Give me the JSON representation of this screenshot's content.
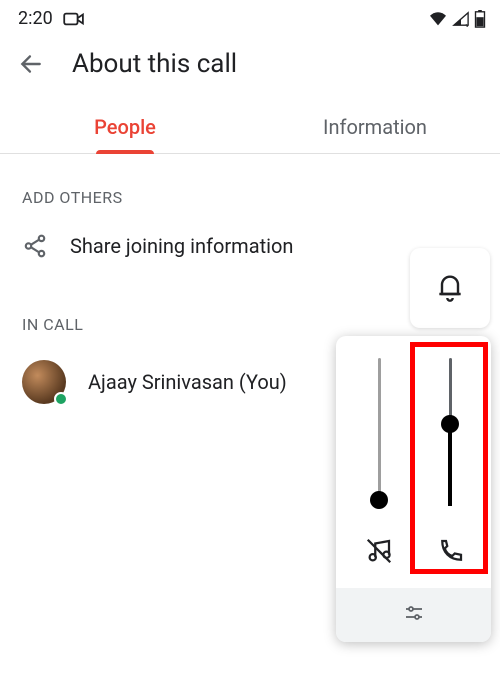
{
  "status": {
    "time": "2:20"
  },
  "header": {
    "title": "About this call"
  },
  "tabs": {
    "people": "People",
    "information": "Information"
  },
  "sections": {
    "add_others": "ADD OTHERS",
    "in_call": "IN CALL"
  },
  "share": {
    "label": "Share joining information"
  },
  "participants": [
    {
      "name": "Ajaay Srinivasan (You)"
    }
  ]
}
